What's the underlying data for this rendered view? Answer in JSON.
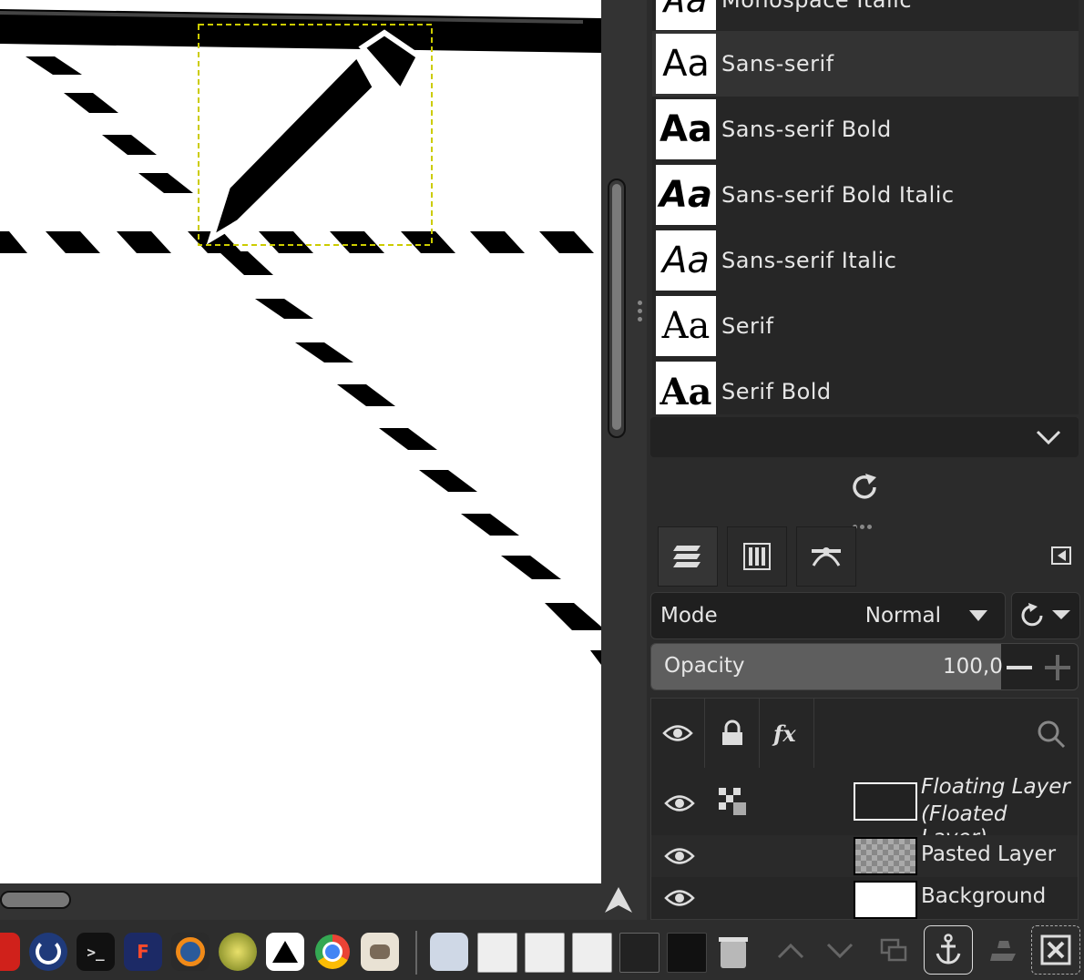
{
  "font_list": {
    "partial_label": "Monospace Italic",
    "items": [
      {
        "preview": "Aa",
        "name": "Sans-serif",
        "selected": true
      },
      {
        "preview": "Aa",
        "name": "Sans-serif Bold"
      },
      {
        "preview": "Aa",
        "name": "Sans-serif Bold Italic"
      },
      {
        "preview": "Aa",
        "name": "Sans-serif Italic"
      },
      {
        "preview": "Aa",
        "name": "Serif"
      },
      {
        "preview": "Aa",
        "name": "Serif Bold"
      }
    ]
  },
  "layers_panel": {
    "mode_label": "Mode",
    "mode_value": "Normal",
    "opacity_label": "Opacity",
    "opacity_value": "100,0",
    "opacity_fraction": 0.82,
    "layers": [
      {
        "name_line1": "Floating Layer",
        "name_line2": "(Floated Layer)"
      },
      {
        "name": "Pasted Layer"
      },
      {
        "name": "Background"
      }
    ]
  },
  "icons": [
    "chevron-down-icon",
    "refresh-icon",
    "layers-tab-icon",
    "channels-tab-icon",
    "paths-tab-icon",
    "panel-menu-icon",
    "eye-icon",
    "lock-icon",
    "fx-icon",
    "search-icon",
    "anchor-icon",
    "close-icon"
  ],
  "colors": {
    "accent_selection": "#ffff00",
    "panel_bg": "#2b2b2b",
    "canvas_bg": "#ffffff"
  }
}
